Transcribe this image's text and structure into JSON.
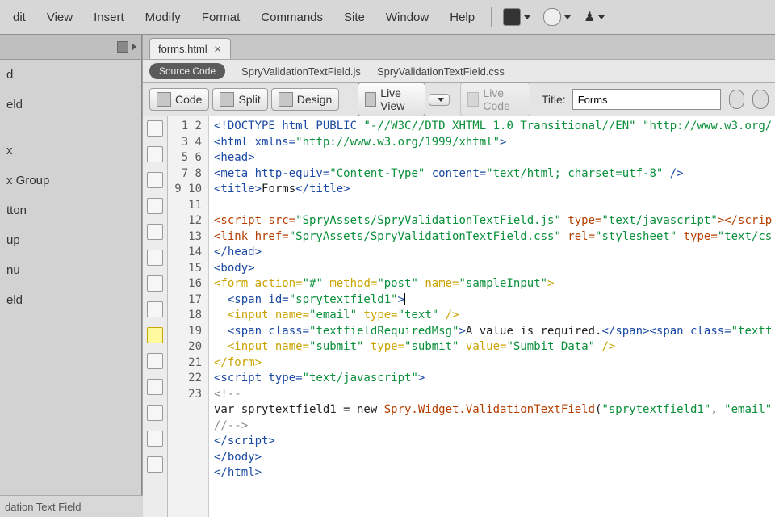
{
  "menu": {
    "items": [
      "dit",
      "View",
      "Insert",
      "Modify",
      "Format",
      "Commands",
      "Site",
      "Window",
      "Help"
    ]
  },
  "left_panel": {
    "items": [
      "d",
      "eld",
      "",
      "x",
      "x Group",
      "tton",
      "up",
      "nu",
      "eld"
    ],
    "footer": "dation Text Field"
  },
  "tab": {
    "name": "forms.html"
  },
  "related": {
    "source_label": "Source Code",
    "file_js": "SpryValidationTextField.js",
    "file_css": "SpryValidationTextField.css"
  },
  "toolbar": {
    "code": "Code",
    "split": "Split",
    "design": "Design",
    "liveview": "Live View",
    "livecode": "Live Code",
    "title_label": "Title:",
    "title_value": "Forms"
  },
  "line_count": 23,
  "code_lines": {
    "l1_a": "<!DOCTYPE html PUBLIC ",
    "l1_b": "\"-//W3C//DTD XHTML 1.0 Transitional//EN\"",
    "l1_c": " ",
    "l1_d": "\"http://www.w3.org/",
    "l2_a": "<html xmlns=",
    "l2_b": "\"http://www.w3.org/1999/xhtml\"",
    "l2_c": ">",
    "l3": "<head>",
    "l4_a": "<meta http-equiv=",
    "l4_b": "\"Content-Type\"",
    "l4_c": " content=",
    "l4_d": "\"text/html; charset=utf-8\"",
    "l4_e": " />",
    "l5_a": "<title>",
    "l5_b": "Forms",
    "l5_c": "</title>",
    "l7_a": "<script src=",
    "l7_b": "\"SpryAssets/SpryValidationTextField.js\"",
    "l7_c": " type=",
    "l7_d": "\"text/javascript\"",
    "l7_e": "></scrip",
    "l8_a": "<link href=",
    "l8_b": "\"SpryAssets/SpryValidationTextField.css\"",
    "l8_c": " rel=",
    "l8_d": "\"stylesheet\"",
    "l8_e": " type=",
    "l8_f": "\"text/cs",
    "l9": "</head>",
    "l10": "<body>",
    "l11_a": "<form",
    "l11_b": " action=",
    "l11_c": "\"#\"",
    "l11_d": " method=",
    "l11_e": "\"post\"",
    "l11_f": " name=",
    "l11_g": "\"sampleInput\"",
    "l11_h": ">",
    "l12_a": "  <span id=",
    "l12_b": "\"sprytextfield1\"",
    "l12_c": ">",
    "l13_a": "  <input",
    "l13_b": " name=",
    "l13_c": "\"email\"",
    "l13_d": " type=",
    "l13_e": "\"text\"",
    "l13_f": " />",
    "l14_a": "  <span class=",
    "l14_b": "\"textfieldRequiredMsg\"",
    "l14_c": ">",
    "l14_d": "A value is required.",
    "l14_e": "</span><span class=",
    "l14_f": "\"textf",
    "l15_a": "  <input",
    "l15_b": " name=",
    "l15_c": "\"submit\"",
    "l15_d": " type=",
    "l15_e": "\"submit\"",
    "l15_f": " value=",
    "l15_g": "\"Sumbit Data\"",
    "l15_h": " />",
    "l16": "</form>",
    "l17_a": "<script type=",
    "l17_b": "\"text/javascript\"",
    "l17_c": ">",
    "l18": "<!--",
    "l19_a": "var sprytextfield1 = new ",
    "l19_b": "Spry.Widget.ValidationTextField",
    "l19_c": "(",
    "l19_d": "\"sprytextfield1\"",
    "l19_e": ", ",
    "l19_f": "\"email\"",
    "l20": "//-->",
    "l21": "</script>",
    "l22": "</body>",
    "l23": "</html>"
  }
}
